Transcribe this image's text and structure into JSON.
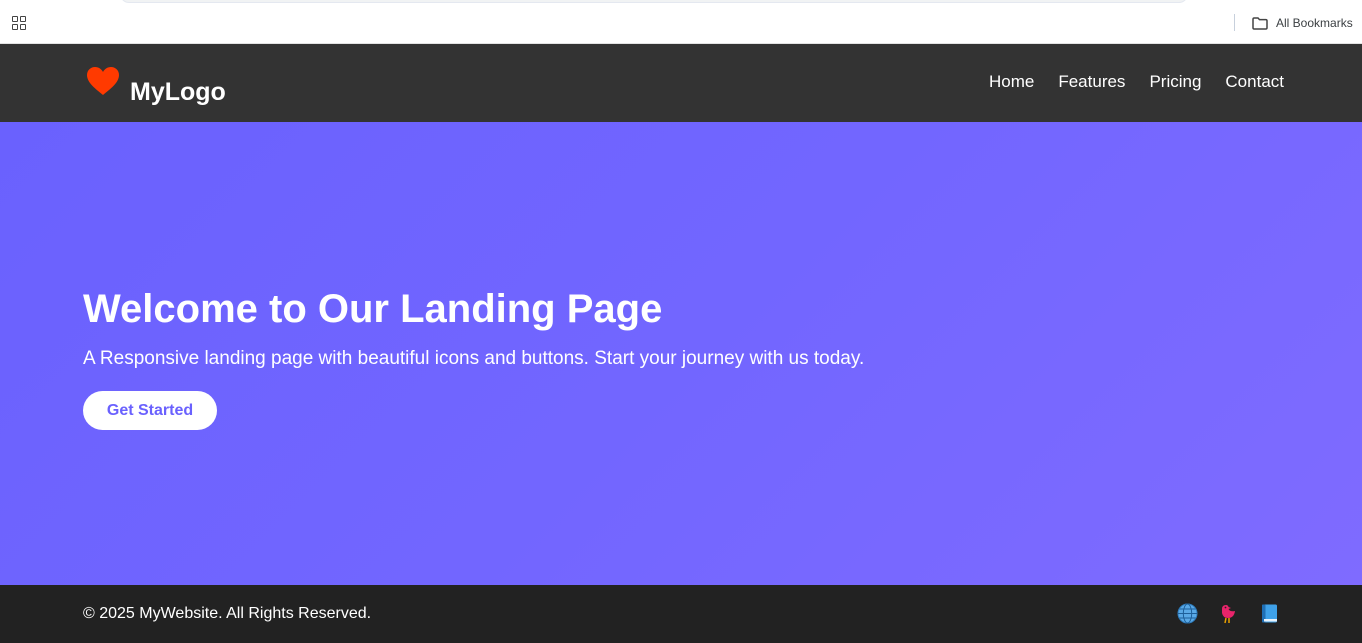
{
  "browser": {
    "bookmarks_label": "All Bookmarks"
  },
  "header": {
    "logo_text": "MyLogo",
    "logo_icon": "heart-icon",
    "nav": [
      {
        "label": "Home"
      },
      {
        "label": "Features"
      },
      {
        "label": "Pricing"
      },
      {
        "label": "Contact"
      }
    ]
  },
  "hero": {
    "title": "Welcome to Our Landing Page",
    "subtitle": "A Responsive landing page with beautiful icons and buttons. Start your journey with us today.",
    "cta_label": "Get Started"
  },
  "footer": {
    "copyright": "© 2025 MyWebsite. All Rights Reserved.",
    "social_icons": [
      "globe-icon",
      "bird-icon",
      "book-icon"
    ]
  },
  "colors": {
    "header_bg": "#333333",
    "hero_gradient_start": "#6a61fe",
    "hero_gradient_end": "#7f6bff",
    "footer_bg": "#222222",
    "heart": "#ff3a00",
    "cta_text": "#6a61fe"
  }
}
